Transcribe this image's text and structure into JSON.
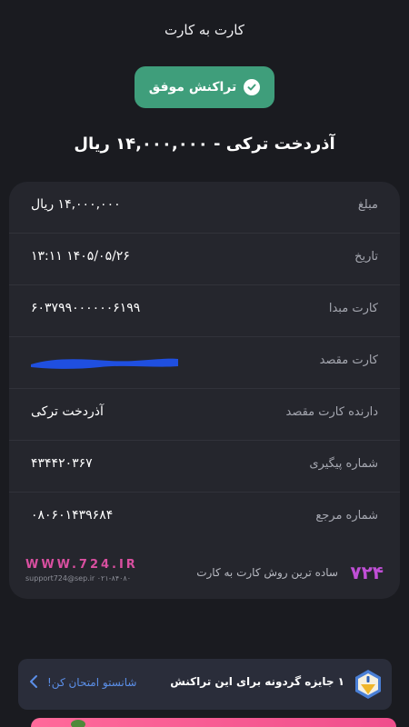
{
  "header": {
    "title": "کارت به کارت"
  },
  "status": {
    "label": "تراکنش موفق",
    "color": "#3f9e7b",
    "icon": "check-circle-icon"
  },
  "transfer": {
    "title": "آذردخت ترکی - ۱۴,۰۰۰,۰۰۰ ریال"
  },
  "receipt": {
    "rows": [
      {
        "label": "مبلغ",
        "value": "۱۴,۰۰۰,۰۰۰ ریال"
      },
      {
        "label": "تاریخ",
        "value": "۱۴۰۵/۰۵/۲۶ ۱۳:۱۱"
      },
      {
        "label": "کارت مبدا",
        "value": "۶۰۳۷۹۹۰۰۰۰۰۰۶۱۹۹"
      },
      {
        "label": "کارت مقصد",
        "value": ""
      },
      {
        "label": "دارنده کارت مقصد",
        "value": "آذردخت ترکی"
      },
      {
        "label": "شماره پیگیری",
        "value": "۴۳۴۴۲۰۳۶۷"
      },
      {
        "label": "شماره مرجع",
        "value": "۰۸۰۶۰۱۴۳۹۶۸۴"
      }
    ]
  },
  "footer": {
    "url": "WWW.724.IR",
    "support": "support724@sep.ir ۰۲۱-۸۴۰۸۰",
    "logo": "۷۲۴",
    "slogan": "ساده ترین روش کارت به کارت"
  },
  "promo": {
    "text": "۱ جایزه گردونه برای این تراکنش",
    "cta": "شانستو امتحان کن!",
    "icon": "prize-wheel-icon"
  },
  "colors": {
    "accent": "#3f9e7b",
    "brand": "#c04fd6",
    "link": "#5b8fe8",
    "redact": "#1f4fe0"
  }
}
